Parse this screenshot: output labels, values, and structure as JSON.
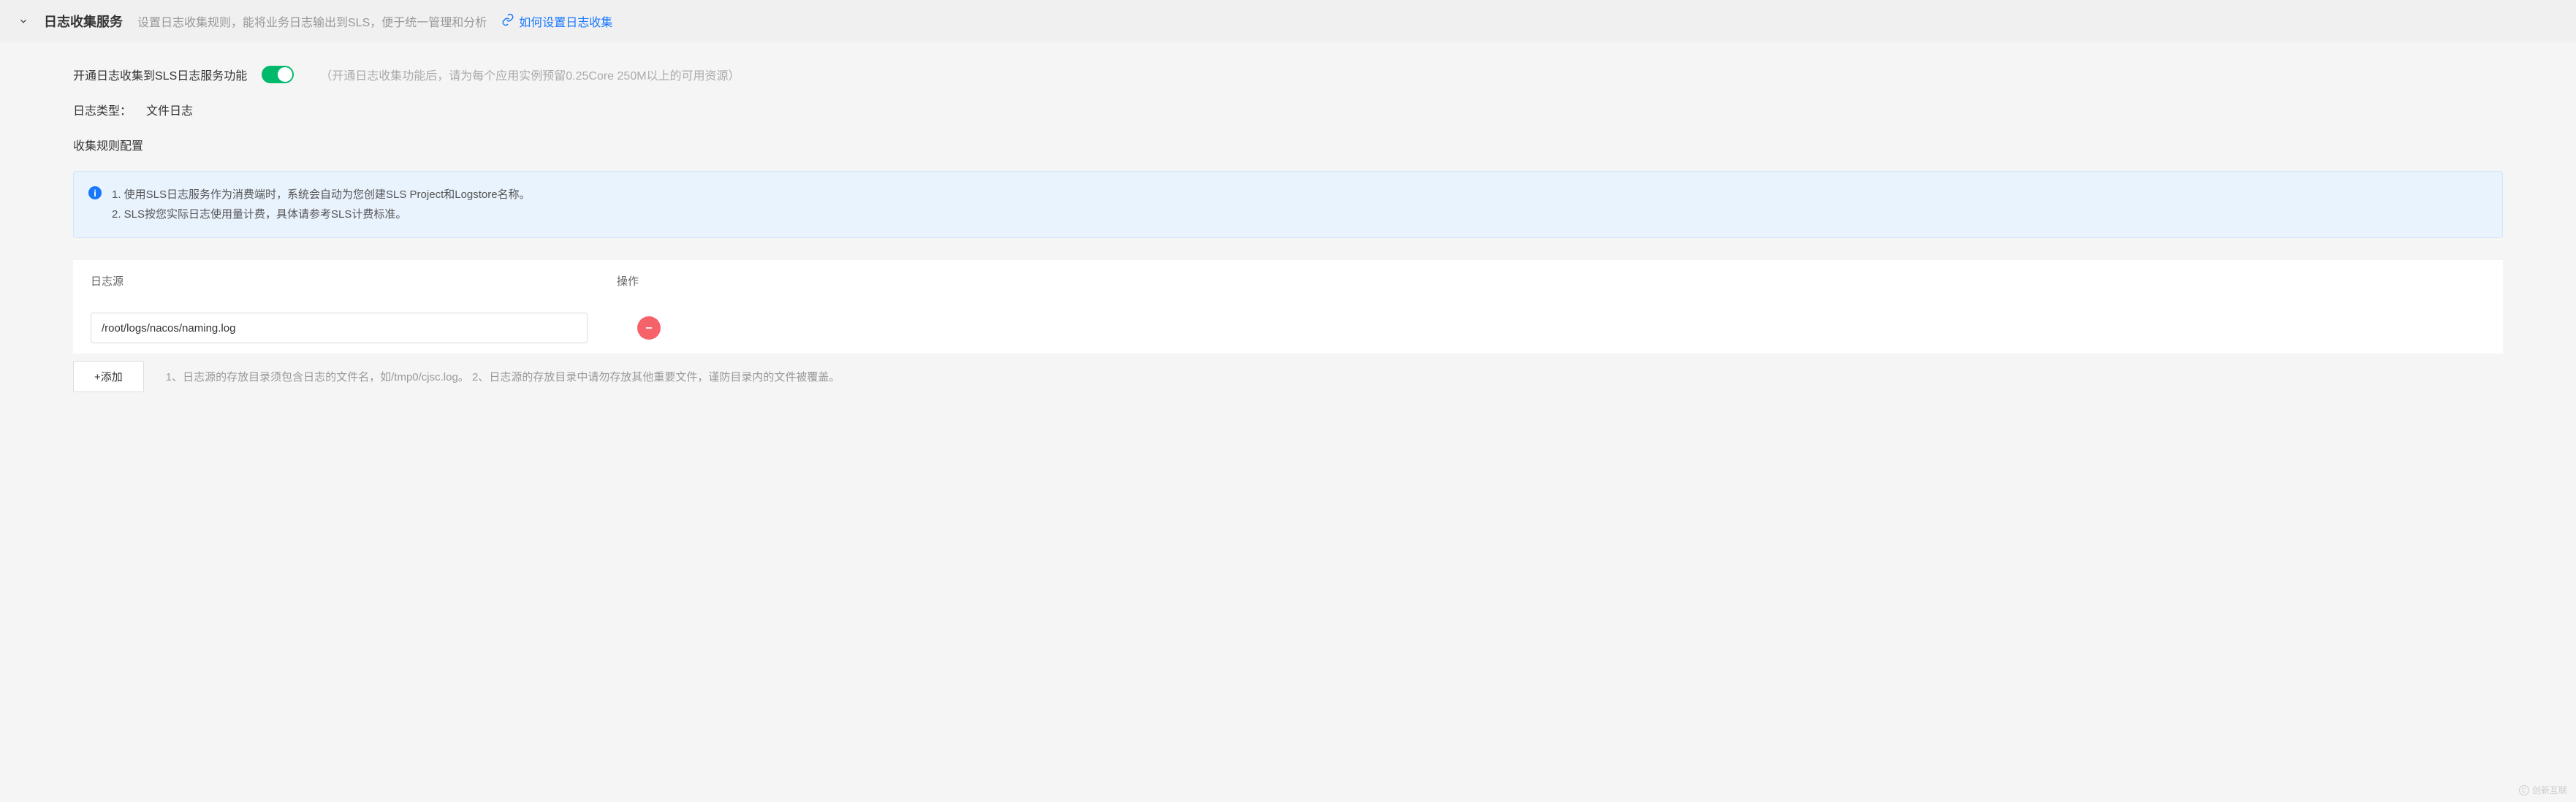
{
  "header": {
    "title": "日志收集服务",
    "description": "设置日志收集规则，能将业务日志输出到SLS，便于统一管理和分析",
    "help_link": "如何设置日志收集"
  },
  "main": {
    "enable_label": "开通日志收集到SLS日志服务功能",
    "enable_hint": "（开通日志收集功能后，请为每个应用实例预留0.25Core 250M以上的可用资源）",
    "log_type_label": "日志类型：",
    "log_type_value": "文件日志",
    "rule_config_label": "收集规则配置",
    "info_line1": "1. 使用SLS日志服务作为消费端时，系统会自动为您创建SLS Project和Logstore名称。",
    "info_line2": "2. SLS按您实际日志使用量计费，具体请参考SLS计费标准。"
  },
  "table": {
    "col_source": "日志源",
    "col_action": "操作",
    "rows": [
      {
        "value": "/root/logs/nacos/naming.log"
      }
    ]
  },
  "footer": {
    "add_button": "+添加",
    "hint": "1、日志源的存放目录须包含日志的文件名，如/tmp0/cjsc.log。 2、日志源的存放目录中请勿存放其他重要文件，谨防目录内的文件被覆盖。"
  },
  "watermark": "创新互联"
}
